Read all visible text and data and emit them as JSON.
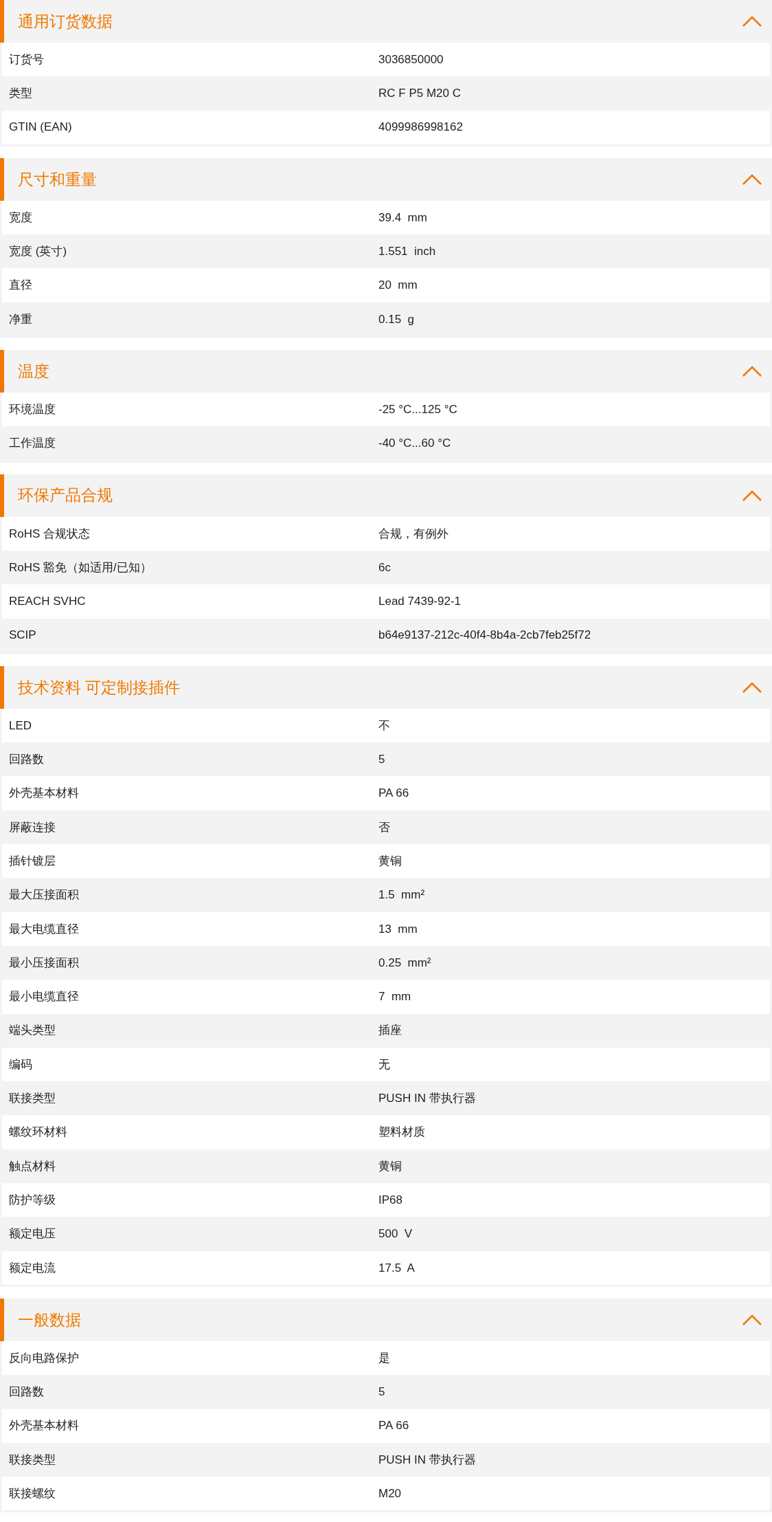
{
  "sections": [
    {
      "title": "通用订货数据",
      "expanded": true,
      "rows": [
        {
          "label": "订货号",
          "value": "3036850000"
        },
        {
          "label": "类型",
          "value": "RC F P5 M20 C"
        },
        {
          "label": "GTIN (EAN)",
          "value": "4099986998162"
        }
      ]
    },
    {
      "title": "尺寸和重量",
      "expanded": true,
      "rows": [
        {
          "label": "宽度",
          "value": "39.4  mm"
        },
        {
          "label": "宽度 (英寸)",
          "value": "1.551  inch"
        },
        {
          "label": "直径",
          "value": "20  mm"
        },
        {
          "label": "净重",
          "value": "0.15  g"
        }
      ]
    },
    {
      "title": "温度",
      "expanded": true,
      "rows": [
        {
          "label": "环境温度",
          "value": "-25 °C...125 °C"
        },
        {
          "label": "工作温度",
          "value": "-40 °C...60 °C"
        }
      ]
    },
    {
      "title": "环保产品合规",
      "expanded": true,
      "rows": [
        {
          "label": "RoHS 合规状态",
          "value": "合规，有例外"
        },
        {
          "label": "RoHS 豁免（如适用/已知）",
          "value": "6c"
        },
        {
          "label": "REACH SVHC",
          "value": "Lead 7439-92-1"
        },
        {
          "label": "SCIP",
          "value": "b64e9137-212c-40f4-8b4a-2cb7feb25f72"
        }
      ]
    },
    {
      "title": "技术资料 可定制接插件",
      "expanded": true,
      "rows": [
        {
          "label": "LED",
          "value": "不"
        },
        {
          "label": "回路数",
          "value": "5"
        },
        {
          "label": "外壳基本材料",
          "value": "PA 66"
        },
        {
          "label": "屏蔽连接",
          "value": "否"
        },
        {
          "label": "插针镀层",
          "value": "黄铜"
        },
        {
          "label": "最大压接面积",
          "value": "1.5  mm²"
        },
        {
          "label": "最大电缆直径",
          "value": "13  mm"
        },
        {
          "label": "最小压接面积",
          "value": "0.25  mm²"
        },
        {
          "label": "最小电缆直径",
          "value": "7  mm"
        },
        {
          "label": "端头类型",
          "value": "插座"
        },
        {
          "label": "编码",
          "value": "无"
        },
        {
          "label": "联接类型",
          "value": "PUSH IN 带执行器"
        },
        {
          "label": "螺纹环材料",
          "value": "塑料材质"
        },
        {
          "label": "触点材料",
          "value": "黄铜"
        },
        {
          "label": "防护等级",
          "value": "IP68"
        },
        {
          "label": "额定电压",
          "value": "500  V"
        },
        {
          "label": "额定电流",
          "value": "17.5  A"
        }
      ]
    },
    {
      "title": "一般数据",
      "expanded": true,
      "rows": [
        {
          "label": "反向电路保护",
          "value": "是"
        },
        {
          "label": "回路数",
          "value": "5"
        },
        {
          "label": "外壳基本材料",
          "value": "PA 66"
        },
        {
          "label": "联接类型",
          "value": "PUSH IN 带执行器"
        },
        {
          "label": "联接螺纹",
          "value": "M20"
        }
      ]
    }
  ]
}
